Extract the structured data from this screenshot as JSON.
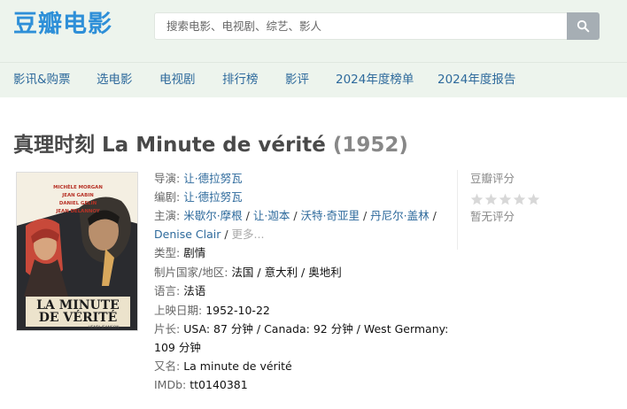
{
  "header": {
    "logo": "豆瓣电影",
    "search_placeholder": "搜索电影、电视剧、综艺、影人"
  },
  "nav": [
    {
      "label": "影讯&购票"
    },
    {
      "label": "选电影"
    },
    {
      "label": "电视剧"
    },
    {
      "label": "排行榜"
    },
    {
      "label": "影评"
    },
    {
      "label": "2024年度榜单"
    },
    {
      "label": "2024年度报告"
    }
  ],
  "movie": {
    "title": "真理时刻 La Minute de vérité",
    "year": "(1952)",
    "poster": {
      "credits_top": [
        "MICHÈLE MORGAN",
        "JEAN GABIN",
        "DANIEL GELIN",
        "JEAN DELANNOY"
      ],
      "title_line1": "LA MINUTE",
      "title_line2": "DE VÉRITÉ",
      "credit_bottom": "HENRI JEANSON"
    },
    "director_label": "导演:",
    "director": "让·德拉努瓦",
    "writer_label": "编剧:",
    "writer": "让·德拉努瓦",
    "cast_label": "主演:",
    "cast": [
      "米歇尔·摩根",
      "让·迦本",
      "沃特·奇亚里",
      "丹尼尔·盖林",
      "Denise Clair"
    ],
    "cast_more": "更多...",
    "genre_label": "类型:",
    "genre": "剧情",
    "country_label": "制片国家/地区:",
    "country": "法国 / 意大利 / 奥地利",
    "language_label": "语言:",
    "language": "法语",
    "release_label": "上映日期:",
    "release_date": "1952-10-22",
    "runtime_label": "片长:",
    "runtime_line1": "USA: 87 分钟 / Canada: 92 分钟 / West Germany:",
    "runtime_line2": "109 分钟",
    "aka_label": "又名:",
    "aka": "La minute de vérité",
    "imdb_label": "IMDb:",
    "imdb": "tt0140381"
  },
  "rating": {
    "label": "豆瓣评分",
    "stars": 0,
    "empty_text": "暂无评分"
  }
}
